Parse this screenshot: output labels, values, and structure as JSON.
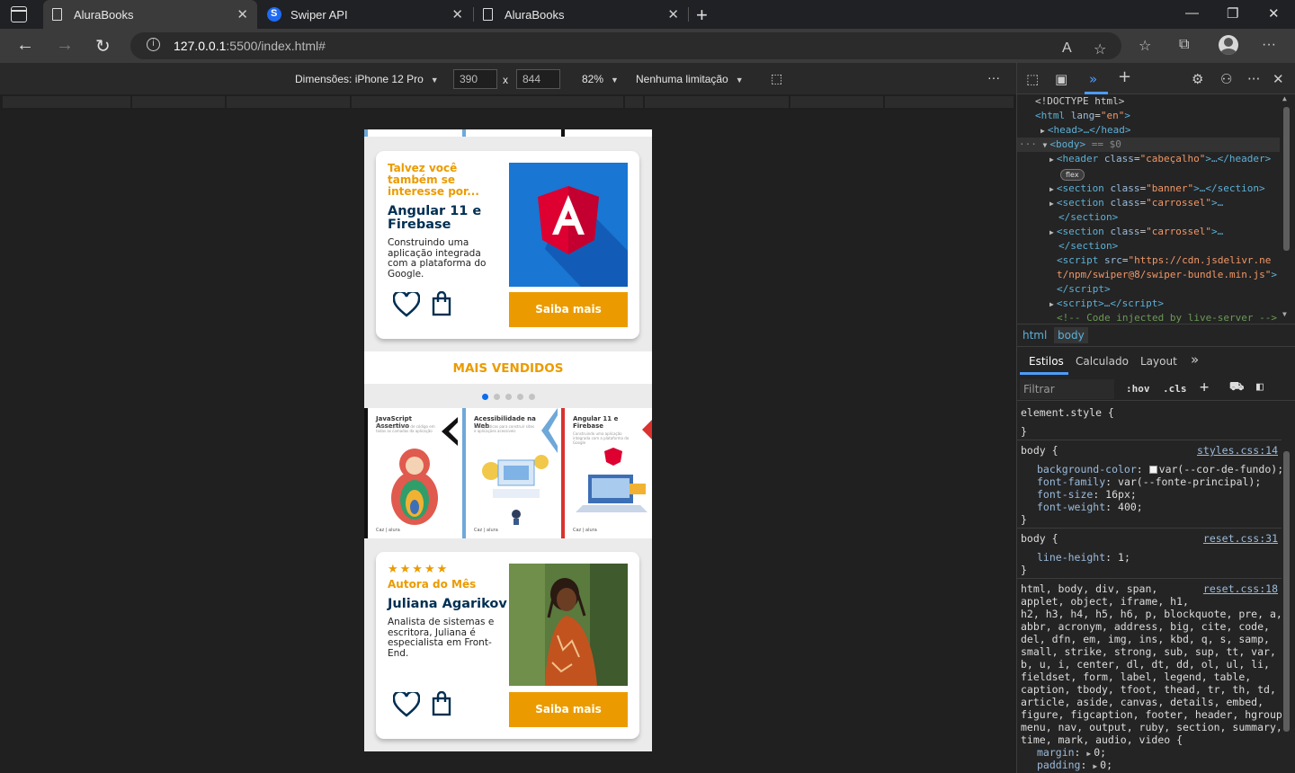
{
  "browser": {
    "tabs": [
      {
        "title": "AluraBooks",
        "active": true
      },
      {
        "title": "Swiper API",
        "active": false
      },
      {
        "title": "AluraBooks",
        "active": false
      }
    ],
    "url_host": "127.0.0.1",
    "url_rest": ":5500/index.html#",
    "read_aloud_label": "A"
  },
  "device_toolbar": {
    "dimensions_label": "Dimensões: iPhone 12 Pro",
    "width": "390",
    "x_label": "x",
    "height": "844",
    "zoom": "82%",
    "throttle": "Nenhuma limitação",
    "more": "···"
  },
  "page": {
    "suggest_card": {
      "kicker": "Talvez você também se interesse por...",
      "title": "Angular 11 e Firebase",
      "description": "Construindo uma aplicação integrada com a plataforma do Google.",
      "button": "Saiba mais"
    },
    "section_title": "MAIS VENDIDOS",
    "pagination_count": 5,
    "books": [
      {
        "title": "JavaScript Assertivo",
        "subtitle": "Testes e qualidade de código em todas as camadas da aplicação",
        "footer": "Caz | alura",
        "accent": "#111111"
      },
      {
        "title": "Acessibilidade na Web",
        "subtitle": "Boas práticas para construir sites e aplicações acessíveis",
        "footer": "Caz | alura",
        "accent": "#6ea8d9"
      },
      {
        "title": "Angular 11 e Firebase",
        "subtitle": "Construindo uma aplicação integrada com a plataforma do Google",
        "footer": "Caz | alura",
        "accent": "#d9322f"
      }
    ],
    "author_card": {
      "stars": "★★★★★",
      "kicker": "Autora do Mês",
      "name": "Juliana Agarikov",
      "description": "Analista de sistemas e escritora, Juliana é especialista em Front-End.",
      "button": "Saiba mais"
    },
    "colors": {
      "accent": "#eb9b00",
      "title": "#002f52",
      "swiper_dot_active": "#0b6cf0"
    }
  },
  "devtools": {
    "elements": {
      "doctype": "<!DOCTYPE html>",
      "html_tag": "html",
      "html_lang_attr": "lang",
      "html_lang_val": "\"en\"",
      "head": "<head>…</head>",
      "body_line": "<body>",
      "body_eq": "== $0",
      "header_class": "\"cabeçalho\"",
      "flex_badge": "flex",
      "section_banner_class": "\"banner\"",
      "section_carrossel_class": "\"carrossel\"",
      "script_src_part1": "\"https://cdn.jsdelivr.ne",
      "script_src_part2": "t/npm/swiper@8/swiper-bundle.min.js\"",
      "comment": "<!-- Code injected by live-server -->"
    },
    "breadcrumbs": [
      "html",
      "body"
    ],
    "style_tabs": [
      "Estilos",
      "Calculado",
      "Layout"
    ],
    "filter_placeholder": "Filtrar",
    "hov": ":hov",
    "cls": ".cls",
    "rules": {
      "element_style": "element.style {",
      "close_brace": "}",
      "body_selector": "body {",
      "styles_source": "styles.css:14",
      "body_props": [
        {
          "name": "background-color",
          "value": "var(--cor-de-fundo);",
          "swatch": true
        },
        {
          "name": "font-family",
          "value": "var(--fonte-principal);"
        },
        {
          "name": "font-size",
          "value": "16px;"
        },
        {
          "name": "font-weight",
          "value": "400;"
        }
      ],
      "reset_source_1": "reset.css:31",
      "line_height_name": "line-height",
      "line_height_value": "1;",
      "reset_source_2": "reset.css:18",
      "reset_selectors": [
        "html, body, div, span,",
        "applet, object, iframe, h1,",
        "h2, h3, h4, h5, h6, p, blockquote, pre, a,",
        "abbr, acronym, address, big, cite, code,",
        "del, dfn, em, img, ins, kbd, q, s, samp,",
        "small, strike, strong, sub, sup, tt, var,",
        "b, u, i, center, dl, dt, dd, ol, ul, li,",
        "fieldset, form, label, legend, table,",
        "caption, tbody, tfoot, thead, tr, th, td,",
        "article, aside, canvas, details, embed,",
        "figure, figcaption, footer, header, hgroup,",
        "menu, nav, output, ruby, section, summary,",
        "time, mark, audio, video {"
      ],
      "margin_name": "margin",
      "margin_value": "0;",
      "padding_name": "padding",
      "padding_value": "0;"
    }
  }
}
